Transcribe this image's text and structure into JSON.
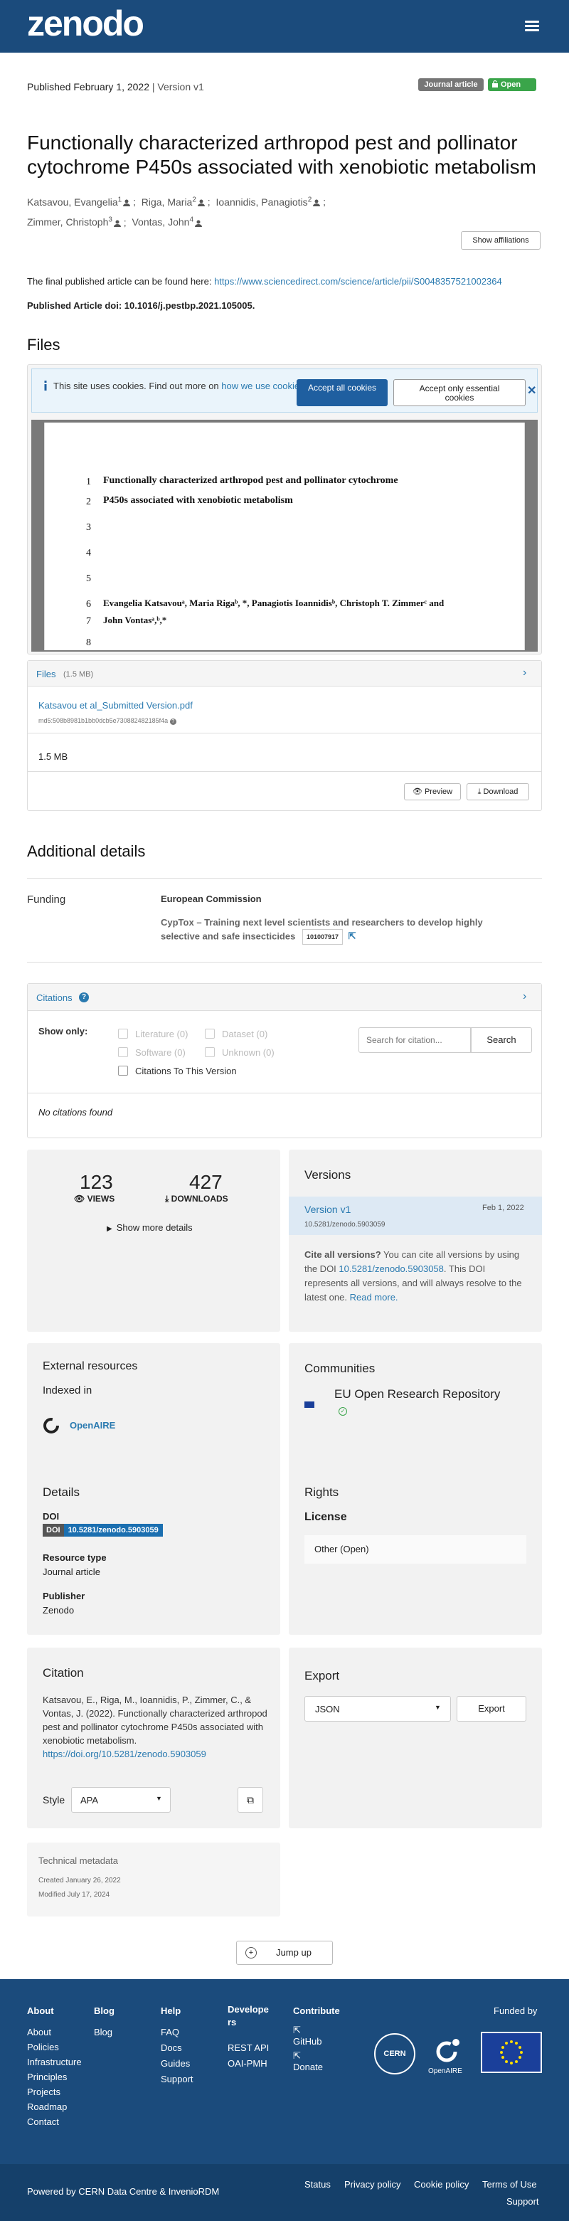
{
  "nav": {
    "logo": "zenodo",
    "menu_icon": "menu-icon"
  },
  "record": {
    "published": "Published February 1, 2022",
    "separator": " | ",
    "version": "Version v1",
    "resource_badge": "Journal article",
    "access_badge": "Open",
    "title": "Functionally characterized arthropod pest and pollinator cytochrome P450s associated with xenobiotic metabolism",
    "authors": [
      {
        "name": "Katsavou, Evangelia",
        "sup": "1"
      },
      {
        "name": "Riga, Maria",
        "sup": "2"
      },
      {
        "name": "Ioannidis, Panagiotis",
        "sup": "2"
      },
      {
        "name": "Zimmer, Christoph",
        "sup": "3"
      },
      {
        "name": "Vontas, John",
        "sup": "4"
      }
    ],
    "show_affiliations": "Show affiliations",
    "description_line1": "The final published article can be found here: ",
    "description_link": "https://www.sciencedirect.com/science/article/pii/S0048357521002364",
    "description_line2": "Published Article doi: 10.1016/j.pestbp.2021.105005."
  },
  "files": {
    "heading": "Files",
    "cookie_text": "This site uses cookies. Find out more on ",
    "cookie_link": "how we use cookies",
    "accept_all": "Accept all cookies",
    "accept_essential": "Accept only essential cookies",
    "preview_lines": [
      {
        "n": "1",
        "t": "Functionally characterized arthropod pest and pollinator cytochrome"
      },
      {
        "n": "2",
        "t": "P450s associated with xenobiotic metabolism"
      },
      {
        "n": "3",
        "t": ""
      },
      {
        "n": "4",
        "t": ""
      },
      {
        "n": "5",
        "t": ""
      },
      {
        "n": "6",
        "t": "Evangelia Katsavouᵃ, Maria Rigaᵇ, *, Panagiotis Ioannidisᵇ, Christoph T. Zimmerᶜ and"
      },
      {
        "n": "7",
        "t": "John Vontasᵃ,ᵇ,*"
      },
      {
        "n": "8",
        "t": ""
      }
    ],
    "files_label": "Files",
    "files_size": "(1.5 MB)",
    "file_name": "Katsavou et al_Submitted Version.pdf",
    "md5": "md5:508b8981b1bb0dcb5e730882482185f4a",
    "file_size": "1.5 MB",
    "preview_btn": "Preview",
    "download_btn": "Download"
  },
  "additional": {
    "heading": "Additional details",
    "funding_label": "Funding",
    "funder": "European Commission",
    "grant_title": "CypTox – Training next level scientists and researchers to develop highly selective and safe insecticides",
    "grant_number": "101007917"
  },
  "citations": {
    "title": "Citations",
    "show_only": "Show only:",
    "filters": [
      "Literature (0)",
      "Dataset (0)",
      "Software (0)",
      "Unknown (0)"
    ],
    "this_version": "Citations To This Version",
    "search_placeholder": "Search for citation...",
    "search_btn": "Search",
    "none": "No citations found"
  },
  "stats": {
    "views": "123",
    "views_label": "VIEWS",
    "downloads": "427",
    "downloads_label": "DOWNLOADS",
    "more": "Show more details"
  },
  "versions": {
    "heading": "Versions",
    "item": "Version v1",
    "item_date": "Feb 1, 2022",
    "item_doi": "10.5281/zenodo.5903059",
    "cite_bold": "Cite all versions?",
    "cite_text1": " You can cite all versions by using the DOI ",
    "cite_doi": "10.5281/zenodo.5903058",
    "cite_text2": ". This DOI represents all versions, and will always resolve to the latest one. ",
    "read_more": "Read more."
  },
  "external": {
    "heading": "External resources",
    "indexed": "Indexed in",
    "openaire": "OpenAIRE"
  },
  "communities": {
    "heading": "Communities",
    "item": "EU Open Research Repository"
  },
  "details": {
    "heading": "Details",
    "doi_label": "DOI",
    "doi_tag": "DOI",
    "doi_value": "10.5281/zenodo.5903059",
    "rtype_label": "Resource type",
    "rtype_value": "Journal article",
    "publisher_label": "Publisher",
    "publisher_value": "Zenodo"
  },
  "rights": {
    "heading": "Rights",
    "license": "License",
    "item": "Other (Open)"
  },
  "citation": {
    "heading": "Citation",
    "text": "Katsavou, E., Riga, M., Ioannidis, P., Zimmer, C., & Vontas, J. (2022). Functionally characterized arthropod pest and pollinator cytochrome P450s associated with xenobiotic metabolism.",
    "link": "https://doi.org/10.5281/zenodo.5903059",
    "style_label": "Style",
    "style_value": "APA"
  },
  "export": {
    "heading": "Export",
    "format": "JSON",
    "button": "Export"
  },
  "tech": {
    "heading": "Technical metadata",
    "created": "Created January 26, 2022",
    "modified": "Modified July 17, 2024"
  },
  "jump": "Jump up",
  "footer": {
    "about_h": "About",
    "about": [
      "About",
      "Policies",
      "Infrastructure",
      "Principles",
      "Projects",
      "Roadmap",
      "Contact"
    ],
    "blog_h": "Blog",
    "blog": [
      "Blog"
    ],
    "help_h": "Help",
    "help": [
      "FAQ",
      "Docs",
      "Guides",
      "Support"
    ],
    "dev_h1": "Develope",
    "dev_h2": "rs",
    "dev": [
      "REST API",
      "OAI-PMH"
    ],
    "contribute_h": "Contribute",
    "contribute": [
      "GitHub",
      "Donate"
    ],
    "funded": "Funded by",
    "cern": "CERN",
    "openaire": "OpenAIRE",
    "powered": "Powered by CERN Data Centre & InvenioRDM",
    "bottom_links": [
      "Status",
      "Privacy policy",
      "Cookie policy",
      "Terms of Use"
    ],
    "support": "Support"
  },
  "colors": {
    "nav": "#1b4b7c",
    "link": "#2a7ab0",
    "open_badge": "#3aa54a",
    "type_badge": "#767676",
    "cookie_btn": "#1f5fa0"
  }
}
